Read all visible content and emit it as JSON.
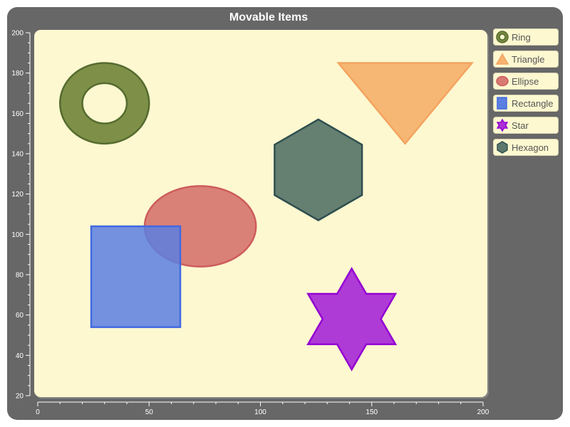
{
  "chart_data": {
    "type": "scatter",
    "title": "Movable Items",
    "xlim": [
      0,
      200
    ],
    "ylim": [
      20,
      200
    ],
    "x_ticks": [
      0,
      50,
      100,
      150,
      200
    ],
    "y_ticks": [
      20,
      40,
      60,
      80,
      100,
      120,
      140,
      160,
      180,
      200
    ],
    "x_minor_step": 10,
    "y_minor_step": 5,
    "grid": false,
    "plot_background": "#fdf8d0",
    "legend_position": "right",
    "items": [
      {
        "name": "Ring",
        "shape": "ring",
        "cx": 30,
        "cy": 165,
        "rx": 20,
        "ry": 20,
        "inner_rx": 10,
        "inner_ry": 10,
        "fill": "#77893f",
        "stroke": "#556b2f"
      },
      {
        "name": "Triangle",
        "shape": "triangle",
        "points": [
          [
            135,
            185
          ],
          [
            195,
            185
          ],
          [
            165,
            145
          ]
        ],
        "fill": "#f7b36f",
        "stroke": "#f4a460"
      },
      {
        "name": "Ellipse",
        "shape": "ellipse",
        "cx": 73,
        "cy": 104,
        "rx": 25,
        "ry": 20,
        "fill": "#d87a72",
        "stroke": "#cd5c5c"
      },
      {
        "name": "Rectangle",
        "shape": "rectangle",
        "x0": 24,
        "y0": 54,
        "x1": 64,
        "y1": 104,
        "fill": "#5b7fe0",
        "stroke": "#4169e1"
      },
      {
        "name": "Star",
        "shape": "star",
        "cx": 141,
        "cy": 58,
        "r": 25,
        "fill": "#ab30d6",
        "stroke": "#9400d3"
      },
      {
        "name": "Hexagon",
        "shape": "hexagon",
        "cx": 126,
        "cy": 132,
        "r": 25,
        "fill": "#5d786c",
        "stroke": "#2f4f4f"
      }
    ]
  }
}
